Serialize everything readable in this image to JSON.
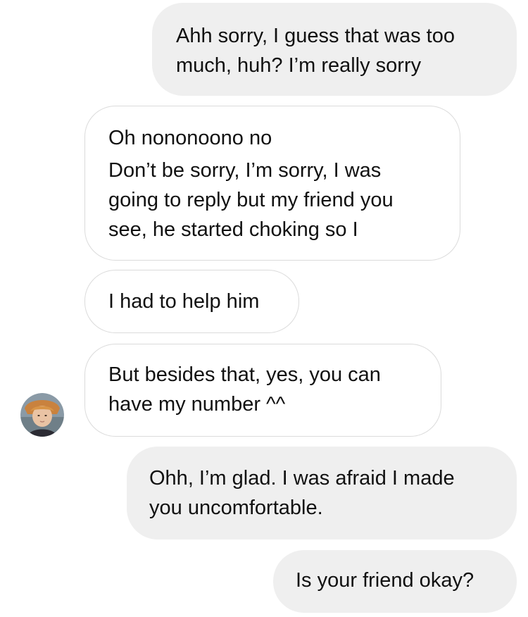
{
  "messages": [
    {
      "from": "me",
      "lines": [
        "Ahh sorry, I guess that was too",
        "much, huh? I’m really sorry"
      ]
    },
    {
      "from": "them",
      "lines": [
        "Oh nononoono no",
        "Don’t be sorry, I’m sorry, I was",
        "going to reply but my friend you",
        "see, he started choking so I"
      ]
    },
    {
      "from": "them",
      "lines": [
        "I had to help him"
      ]
    },
    {
      "from": "them",
      "lines": [
        "But besides that, yes, you can",
        "have my number ^^"
      ]
    },
    {
      "from": "me",
      "lines": [
        "Ohh, I’m glad. I was afraid I made",
        "you uncomfortable."
      ]
    },
    {
      "from": "me",
      "lines": [
        "Is your friend okay?"
      ]
    }
  ],
  "avatar": {
    "icon": "profile-photo-avatar"
  },
  "colors": {
    "sent_bubble": "#efefef",
    "received_border": "#dbdbdb",
    "text": "#111111"
  }
}
